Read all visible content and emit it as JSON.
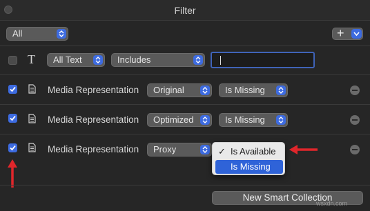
{
  "window": {
    "title": "Filter"
  },
  "top": {
    "scope_select": "All",
    "add_button": "+"
  },
  "rows": [
    {
      "checked": false,
      "icon": "text-icon",
      "icon_glyph": "T",
      "label": "",
      "field": "All Text",
      "operator": "Includes",
      "value": ""
    },
    {
      "checked": true,
      "icon": "document-icon",
      "label": "Media Representation",
      "field": "Original",
      "operator": "Is Missing"
    },
    {
      "checked": true,
      "icon": "document-icon",
      "label": "Media Representation",
      "field": "Optimized",
      "operator": "Is Missing"
    },
    {
      "checked": true,
      "icon": "document-icon",
      "label": "Media Representation",
      "field": "Proxy",
      "operator": "Is Missing"
    }
  ],
  "dropdown_menu": {
    "items": [
      {
        "label": "Is Available",
        "checkmark": "✓",
        "checked": true,
        "highlighted": false
      },
      {
        "label": "Is Missing",
        "checkmark": "",
        "checked": false,
        "highlighted": true
      }
    ]
  },
  "annotations": {
    "arrow_color": "#e0262b"
  },
  "footer": {
    "new_smart_collection": "New Smart Collection"
  },
  "watermark": "wsxdn.com",
  "colors": {
    "accent": "#3d6be0",
    "menu_highlight": "#2f63d8",
    "arrow": "#e0262b"
  }
}
